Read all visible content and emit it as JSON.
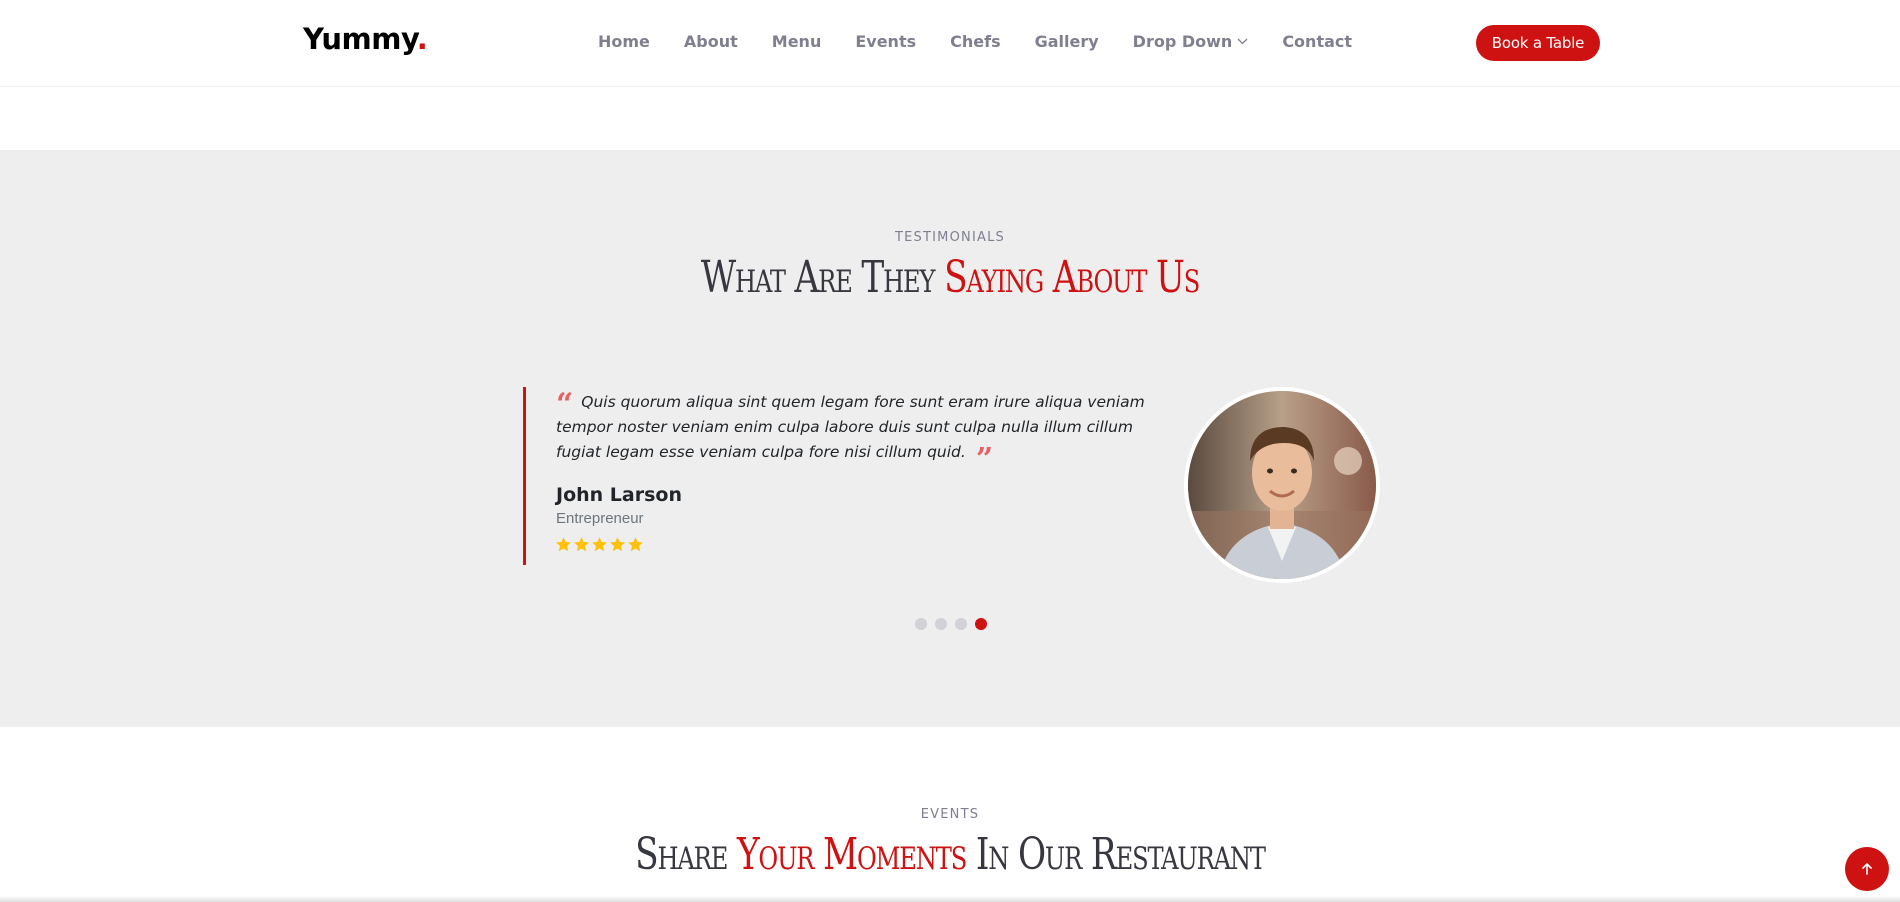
{
  "header": {
    "logo": "Yummy",
    "logo_dot": ".",
    "nav": [
      "Home",
      "About",
      "Menu",
      "Events",
      "Chefs",
      "Gallery",
      "Drop Down",
      "Contact"
    ],
    "cta": "Book a Table"
  },
  "testimonials": {
    "subtitle": "TESTIMONIALS",
    "title_plain": "What Are They",
    "title_accent": "Saying About Us",
    "quote": "Quis quorum aliqua sint quem legam fore sunt eram irure aliqua veniam tempor noster veniam enim culpa labore duis sunt culpa nulla illum cillum fugiat legam esse veniam culpa fore nisi cillum quid.",
    "quote_open": "“",
    "quote_close": "”",
    "name": "John Larson",
    "role": "Entrepreneur",
    "rating_stars": 5,
    "slides_total": 4,
    "active_slide": 4,
    "avatar_icon": "person-portrait-photo"
  },
  "events": {
    "subtitle": "EVENTS",
    "title_plain_1": "Share",
    "title_accent": "Your Moments",
    "title_plain_2": "In Our Restaurant"
  },
  "colors": {
    "accent": "#ce1212",
    "nav_text": "#7f7f90",
    "section_bg": "#eeeeee",
    "star": "#ffc107"
  },
  "icons": {
    "dropdown": "chevron-down-icon",
    "back_to_top": "arrow-up-icon",
    "rating": "star-icon"
  }
}
